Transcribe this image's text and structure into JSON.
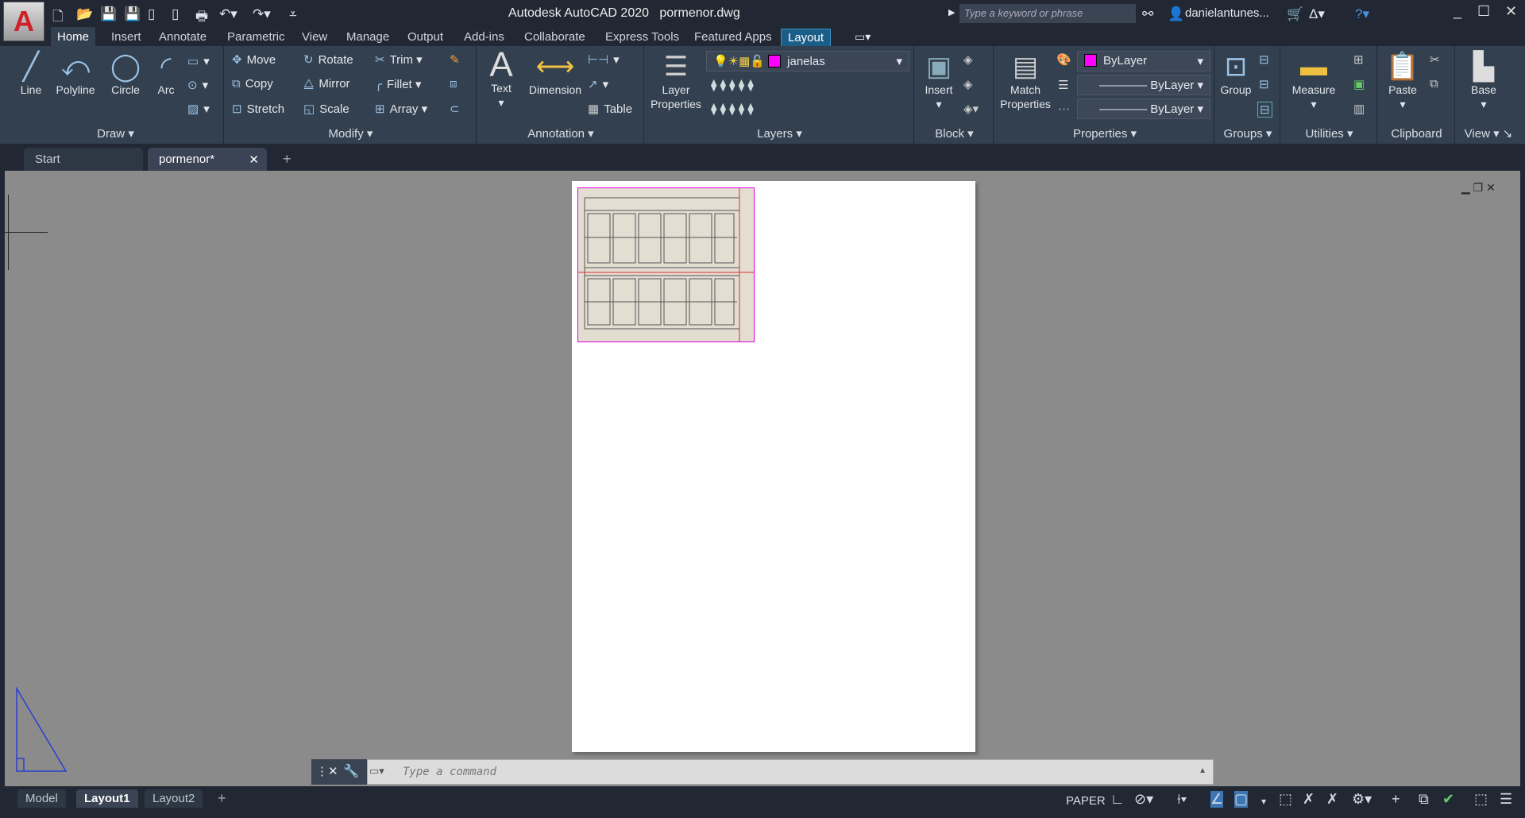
{
  "app": {
    "title": "Autodesk AutoCAD 2020",
    "file": "pormenor.dwg",
    "logo": "A"
  },
  "search": {
    "placeholder": "Type a keyword or phrase"
  },
  "user": {
    "name": "danielantunes..."
  },
  "ribbon_tabs": [
    "Home",
    "Insert",
    "Annotate",
    "Parametric",
    "View",
    "Manage",
    "Output",
    "Add-ins",
    "Collaborate",
    "Express Tools",
    "Featured Apps",
    "Layout"
  ],
  "active_tab": "Home",
  "panels": {
    "draw": {
      "title": "Draw",
      "items": [
        "Line",
        "Polyline",
        "Circle",
        "Arc"
      ]
    },
    "modify": {
      "title": "Modify",
      "items": [
        "Move",
        "Rotate",
        "Trim",
        "Copy",
        "Mirror",
        "Fillet",
        "Stretch",
        "Scale",
        "Array"
      ]
    },
    "annotation": {
      "title": "Annotation",
      "items": [
        "Text",
        "Dimension",
        "Table"
      ]
    },
    "layers": {
      "title": "Layers",
      "layer_props": "Layer Properties",
      "current_layer": "janelas"
    },
    "block": {
      "title": "Block",
      "insert": "Insert"
    },
    "properties": {
      "title": "Properties",
      "match": "Match Properties",
      "color": "ByLayer",
      "linetype": "ByLayer",
      "lineweight": "ByLayer"
    },
    "groups": {
      "title": "Groups",
      "group": "Group"
    },
    "utilities": {
      "title": "Utilities",
      "measure": "Measure"
    },
    "clipboard": {
      "title": "Clipboard",
      "paste": "Paste"
    },
    "view": {
      "title": "View",
      "base": "Base"
    }
  },
  "doc_tabs": [
    "Start",
    "pormenor*"
  ],
  "command": {
    "placeholder": "Type a command"
  },
  "layout_tabs": [
    "Model",
    "Layout1",
    "Layout2"
  ],
  "active_layout": "Layout1",
  "status": {
    "space": "PAPER"
  },
  "colors": {
    "accent": "#1a5d86",
    "layer_color": "#ff00ff",
    "viewport_border": "#e000e0"
  }
}
